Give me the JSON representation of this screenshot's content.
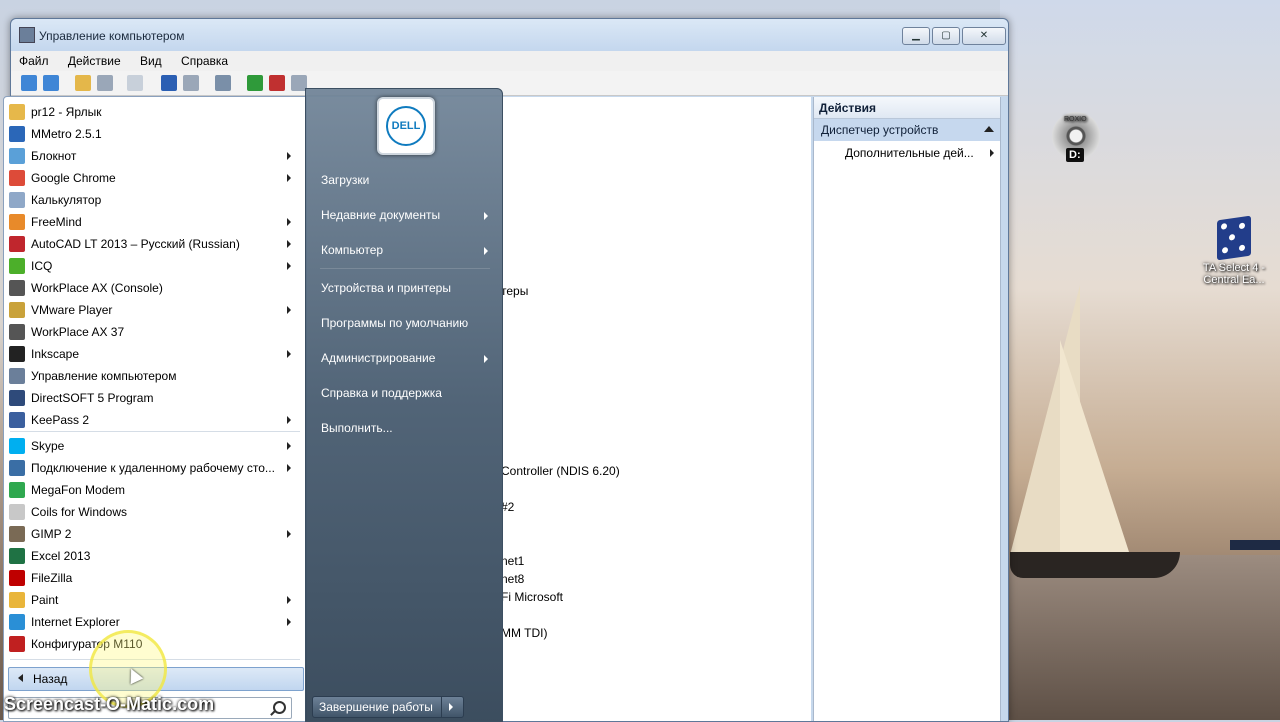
{
  "window": {
    "title": "Управление компьютером",
    "menu": [
      "Файл",
      "Действие",
      "Вид",
      "Справка"
    ],
    "content_lines": [
      "теры",
      "Controller (NDIS 6.20)",
      "#2",
      "net1",
      "net8",
      "Fi Microsoft",
      "MM TDI)"
    ],
    "actions": {
      "header": "Действия",
      "section": "Диспетчер устройств",
      "item": "Дополнительные дей..."
    }
  },
  "desktop": {
    "roxio_drive": "D:",
    "roxio_brand": "ROXIO",
    "ta_label_line1": "TA Select 4 -",
    "ta_label_line2": "Central Ea..."
  },
  "start_menu": {
    "programs": [
      {
        "label": "pr12 - Ярлык",
        "icon": "folder-icon",
        "color": "#e6b84a",
        "arrow": false
      },
      {
        "label": "MMetro 2.5.1",
        "icon": "mmetro-icon",
        "color": "#2b67b8",
        "arrow": false
      },
      {
        "label": "Блокнот",
        "icon": "notepad-icon",
        "color": "#5aa0d8",
        "arrow": true
      },
      {
        "label": "Google Chrome",
        "icon": "chrome-icon",
        "color": "#dd4b39",
        "arrow": true
      },
      {
        "label": "Калькулятор",
        "icon": "calculator-icon",
        "color": "#8fa8c8",
        "arrow": false
      },
      {
        "label": "FreeMind",
        "icon": "freemind-icon",
        "color": "#e88a2a",
        "arrow": true
      },
      {
        "label": "AutoCAD LT 2013 – Русский (Russian)",
        "icon": "autocad-icon",
        "color": "#c0262d",
        "arrow": true
      },
      {
        "label": "ICQ",
        "icon": "icq-icon",
        "color": "#4caf2a",
        "arrow": true
      },
      {
        "label": "WorkPlace AX (Console)",
        "icon": "workplace-icon",
        "color": "#555555",
        "arrow": false
      },
      {
        "label": "VMware Player",
        "icon": "vmware-icon",
        "color": "#c9a23a",
        "arrow": true
      },
      {
        "label": "WorkPlace AX 37",
        "icon": "workplace-ax-icon",
        "color": "#555555",
        "arrow": false
      },
      {
        "label": "Inkscape",
        "icon": "inkscape-icon",
        "color": "#222222",
        "arrow": true
      },
      {
        "label": "Управление компьютером",
        "icon": "computer-management-icon",
        "color": "#6b7f9a",
        "arrow": false
      },
      {
        "label": "DirectSOFT 5 Program",
        "icon": "directsoft-icon",
        "color": "#2e4a7a",
        "arrow": false
      },
      {
        "label": "KeePass 2",
        "icon": "keepass-icon",
        "color": "#3b5f9e",
        "arrow": true
      },
      {
        "label": "Skype",
        "icon": "skype-icon",
        "color": "#00aff0",
        "arrow": true
      },
      {
        "label": "Подключение к удаленному рабочему сто...",
        "icon": "remote-desktop-icon",
        "color": "#3a6ea5",
        "arrow": true
      },
      {
        "label": "MegaFon Modem",
        "icon": "megafon-icon",
        "color": "#2fa84f",
        "arrow": false
      },
      {
        "label": "Coils for Windows",
        "icon": "coils-icon",
        "color": "#c8c8c8",
        "arrow": false
      },
      {
        "label": "GIMP 2",
        "icon": "gimp-icon",
        "color": "#7a6a55",
        "arrow": true
      },
      {
        "label": "Excel 2013",
        "icon": "excel-icon",
        "color": "#1f7244",
        "arrow": false
      },
      {
        "label": "FileZilla",
        "icon": "filezilla-icon",
        "color": "#bf0000",
        "arrow": false
      },
      {
        "label": "Paint",
        "icon": "paint-icon",
        "color": "#e9b53a",
        "arrow": true
      },
      {
        "label": "Internet Explorer",
        "icon": "ie-icon",
        "color": "#2a8fd6",
        "arrow": true
      },
      {
        "label": "Конфигуратор M110",
        "icon": "configurator-icon",
        "color": "#c02020",
        "arrow": false
      }
    ],
    "back_label": "Назад",
    "dell_logo": "DELL",
    "right_links": [
      {
        "label": "Загрузки",
        "arrow": false
      },
      {
        "label": "Недавние документы",
        "arrow": true
      },
      {
        "label": "Компьютер",
        "arrow": true
      },
      {
        "label": "Устройства и принтеры",
        "arrow": false
      },
      {
        "label": "Программы по умолчанию",
        "arrow": false
      },
      {
        "label": "Администрирование",
        "arrow": true
      },
      {
        "label": "Справка и поддержка",
        "arrow": false
      },
      {
        "label": "Выполнить...",
        "arrow": false
      }
    ],
    "shutdown_label": "Завершение работы"
  },
  "watermark": "Screencast-O-Matic.com"
}
